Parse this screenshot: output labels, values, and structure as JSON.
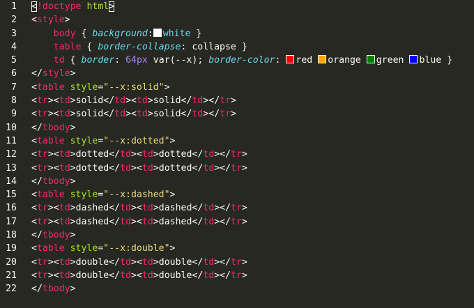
{
  "line_numbers": [
    "1",
    "2",
    "3",
    "4",
    "5",
    "6",
    "7",
    "8",
    "9",
    "10",
    "11",
    "12",
    "13",
    "14",
    "15",
    "16",
    "17",
    "18",
    "19",
    "20",
    "21",
    "22"
  ],
  "colors": {
    "background": "#272822",
    "tag": "#f92672",
    "attribute": "#a6e22e",
    "string": "#e6db74",
    "property": "#66d9ef",
    "number": "#ae81ff",
    "text": "#f8f8f2",
    "swatch_white": "#ffffff",
    "swatch_red": "#ff0000",
    "swatch_orange": "#ffa500",
    "swatch_green": "#008000",
    "swatch_blue": "#0000ff"
  },
  "tokens": {
    "lt": "<",
    "gt": ">",
    "lt_slash": "</",
    "doctype_bang": "!",
    "doctype": "doctype",
    "html_attr": "html",
    "style": "style",
    "table": "table",
    "tr": "tr",
    "td": "td",
    "tbody": "tbody",
    "eq": "=",
    "style_attr": "style",
    "solid_val": "\"--x:solid\"",
    "dotted_val": "\"--x:dotted\"",
    "dashed_val": "\"--x:dashed\"",
    "double_val": "\"--x:double\"",
    "solid": "solid",
    "dotted": "dotted",
    "dashed": "dashed",
    "double": "double"
  },
  "css": {
    "body_sel": "body",
    "table_sel": "table",
    "td_sel": "td",
    "open_brace": "{",
    "close_brace": "}",
    "background_prop": "background",
    "white": "white",
    "border_collapse_prop": "border-collapse",
    "collapse": "collapse",
    "border_prop": "border",
    "border_num": "64px",
    "var_open": "var(",
    "var_name": "--x",
    "var_close": ");",
    "border_color_prop": "border-color",
    "red": "red",
    "orange": "orange",
    "green": "green",
    "blue": "blue",
    "colon": ":",
    "semicolon": ";"
  }
}
